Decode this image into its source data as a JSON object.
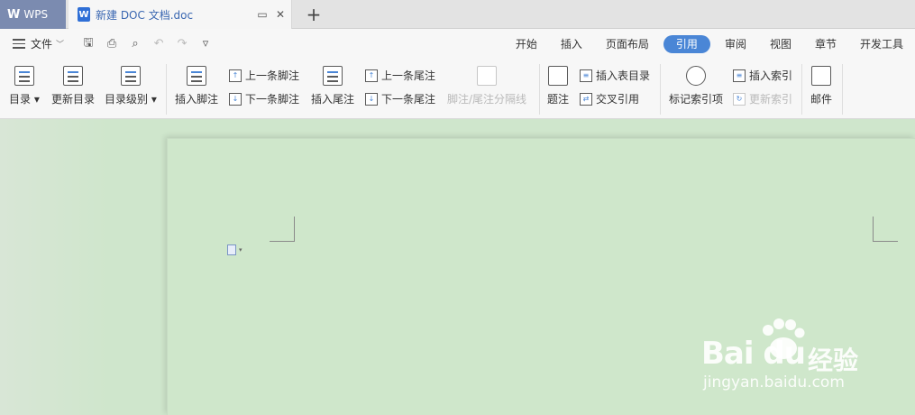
{
  "titlebar": {
    "app_tab": "WPS",
    "doc_tab": "新建 DOC 文档.doc",
    "doc_tab_icon": "W"
  },
  "menubar": {
    "file_label": "文件",
    "tabs": [
      "开始",
      "插入",
      "页面布局",
      "引用",
      "审阅",
      "视图",
      "章节",
      "开发工具"
    ],
    "active_tab": "引用"
  },
  "ribbon": {
    "toc": "目录",
    "update_toc": "更新目录",
    "toc_level": "目录级别",
    "insert_footnote": "插入脚注",
    "prev_footnote": "上一条脚注",
    "next_footnote": "下一条脚注",
    "insert_endnote": "插入尾注",
    "prev_endnote": "上一条尾注",
    "next_endnote": "下一条尾注",
    "footnote_separator": "脚注/尾注分隔线",
    "caption": "题注",
    "insert_table_of_figures": "插入表目录",
    "cross_reference": "交叉引用",
    "mark_index_entry": "标记索引项",
    "insert_index": "插入索引",
    "update_index": "更新索引",
    "mail": "邮件"
  },
  "watermark": {
    "brand": "Bai  du",
    "cn": "经验",
    "url": "jingyan.baidu.com"
  },
  "colors": {
    "accent": "#4a86d6",
    "page_bg": "#cfe7cb",
    "wps_tab": "#7b8bb0"
  }
}
